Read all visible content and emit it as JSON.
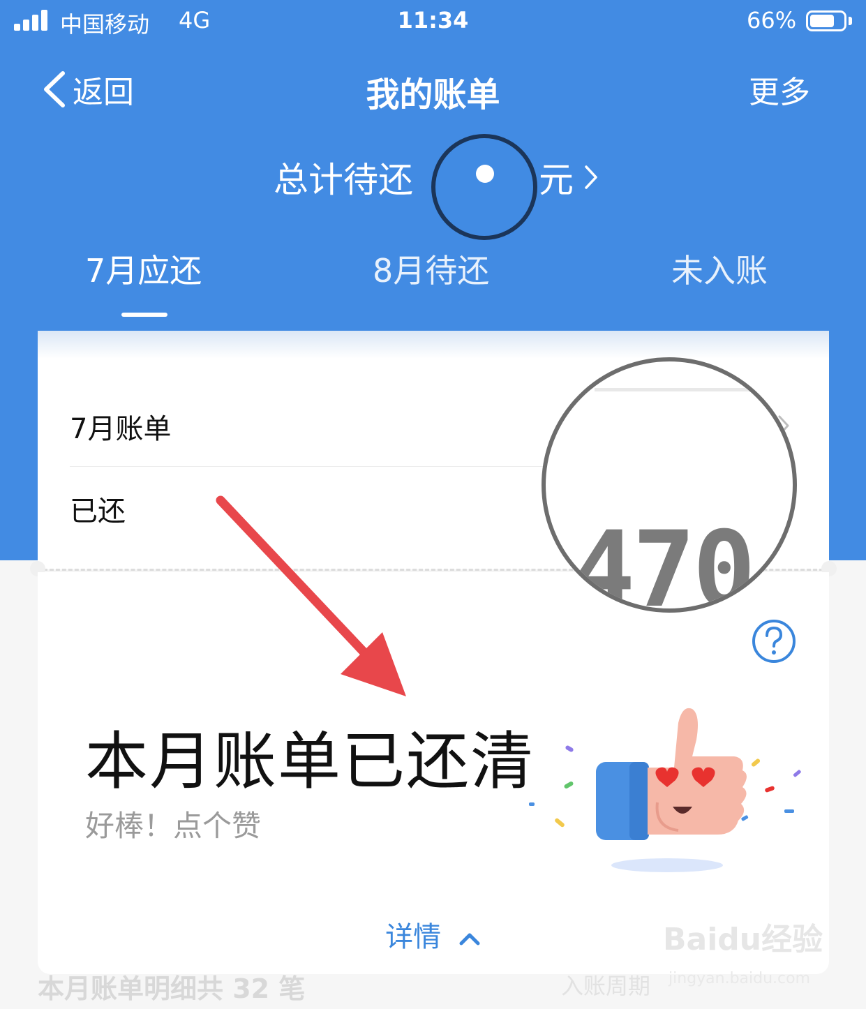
{
  "status_bar": {
    "carrier": "中国移动",
    "network": "4G",
    "time": "11:34",
    "battery": "66%",
    "battery_level": 0.66
  },
  "nav": {
    "back_label": "返回",
    "title": "我的账单",
    "more_label": "更多"
  },
  "summary": {
    "label": "总计待还",
    "amount": "",
    "unit": "元"
  },
  "tabs": [
    {
      "label": "7月应还",
      "active": true
    },
    {
      "label": "8月待还",
      "active": false
    },
    {
      "label": "未入账",
      "active": false
    }
  ],
  "bill": {
    "row1_label": "7月账单",
    "row2_label": "已还",
    "zoom_text": "470"
  },
  "status_card": {
    "headline": "本月账单已还清",
    "subtext": "好棒！点个赞",
    "details_label": "详情"
  },
  "footer": {
    "count_text": "本月账单明细共 32 笔",
    "right_text": "入账周期"
  },
  "watermark": {
    "brand": "Baidu经验",
    "url": "jingyan.baidu.com"
  },
  "colors": {
    "header_blue": "#428be3",
    "link_blue": "#3a86dc",
    "annotation_red": "#e8474b"
  }
}
